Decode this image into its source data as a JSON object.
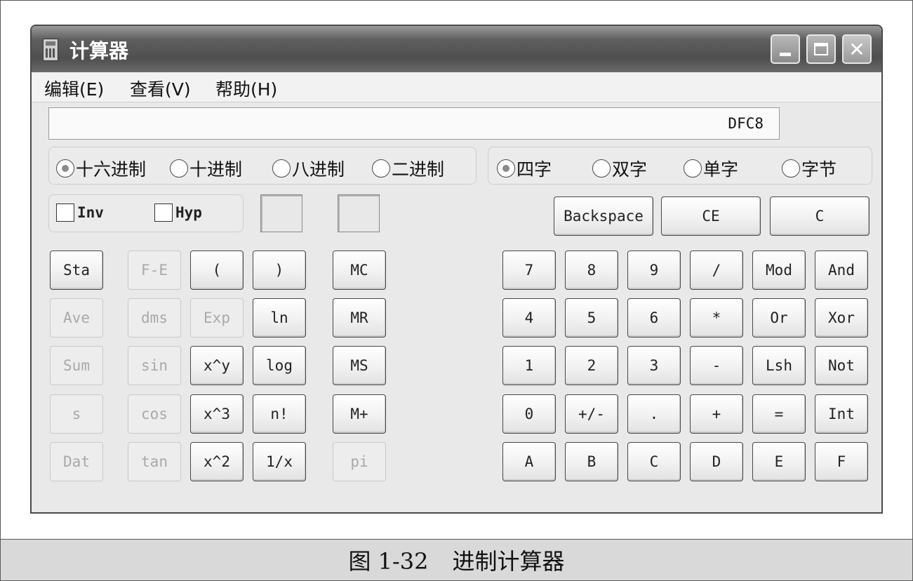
{
  "window": {
    "title": "计算器"
  },
  "menu": [
    {
      "label": "编辑(E)"
    },
    {
      "label": "查看(V)"
    },
    {
      "label": "帮助(H)"
    }
  ],
  "display": {
    "value": "DFC8"
  },
  "base_modes": [
    {
      "label": "十六进制",
      "selected": true
    },
    {
      "label": "十进制",
      "selected": false
    },
    {
      "label": "八进制",
      "selected": false
    },
    {
      "label": "二进制",
      "selected": false
    }
  ],
  "word_modes": [
    {
      "label": "四字",
      "selected": true
    },
    {
      "label": "双字",
      "selected": false
    },
    {
      "label": "单字",
      "selected": false
    },
    {
      "label": "字节",
      "selected": false
    }
  ],
  "checks": [
    {
      "label": "Inv",
      "checked": false
    },
    {
      "label": "Hyp",
      "checked": false
    }
  ],
  "edit_keys": [
    "Backspace",
    "CE",
    "C"
  ],
  "scientific_keys": [
    [
      {
        "label": "Sta",
        "enabled": true
      },
      {
        "label": "F-E",
        "enabled": false
      },
      {
        "label": "(",
        "enabled": true
      },
      {
        "label": ")",
        "enabled": true
      }
    ],
    [
      {
        "label": "Ave",
        "enabled": false
      },
      {
        "label": "dms",
        "enabled": false
      },
      {
        "label": "Exp",
        "enabled": false
      },
      {
        "label": "ln",
        "enabled": true
      }
    ],
    [
      {
        "label": "Sum",
        "enabled": false
      },
      {
        "label": "sin",
        "enabled": false
      },
      {
        "label": "x^y",
        "enabled": true
      },
      {
        "label": "log",
        "enabled": true
      }
    ],
    [
      {
        "label": "s",
        "enabled": false
      },
      {
        "label": "cos",
        "enabled": false
      },
      {
        "label": "x^3",
        "enabled": true
      },
      {
        "label": "n!",
        "enabled": true
      }
    ],
    [
      {
        "label": "Dat",
        "enabled": false
      },
      {
        "label": "tan",
        "enabled": false
      },
      {
        "label": "x^2",
        "enabled": true
      },
      {
        "label": "1/x",
        "enabled": true
      }
    ]
  ],
  "memory_keys": [
    {
      "label": "MC",
      "enabled": true
    },
    {
      "label": "MR",
      "enabled": true
    },
    {
      "label": "MS",
      "enabled": true
    },
    {
      "label": "M+",
      "enabled": true
    },
    {
      "label": "pi",
      "enabled": false
    }
  ],
  "number_keys": [
    [
      "7",
      "8",
      "9",
      "/",
      "Mod",
      "And"
    ],
    [
      "4",
      "5",
      "6",
      "*",
      "Or",
      "Xor"
    ],
    [
      "1",
      "2",
      "3",
      "-",
      "Lsh",
      "Not"
    ],
    [
      "0",
      "+/-",
      ".",
      "+",
      "=",
      "Int"
    ],
    [
      "A",
      "B",
      "C",
      "D",
      "E",
      "F"
    ]
  ],
  "caption": {
    "figure": "图 1-32",
    "text": "进制计算器"
  }
}
